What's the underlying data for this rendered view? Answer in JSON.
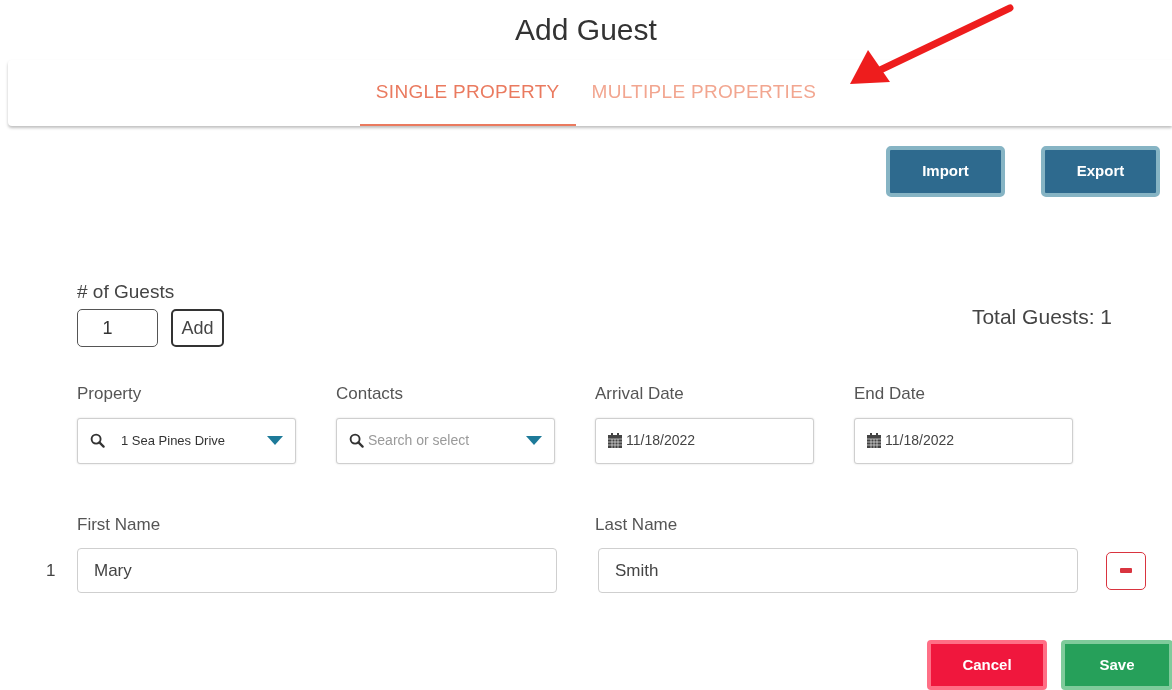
{
  "title": "Add Guest",
  "tabs": [
    {
      "label": "SINGLE PROPERTY",
      "selected": true
    },
    {
      "label": "MULTIPLE PROPERTIES",
      "selected": false
    }
  ],
  "toolbar": [
    "Import",
    "Export"
  ],
  "guest_count": {
    "label": "# of Guests",
    "value": "1",
    "button": "Add"
  },
  "total_guests": "Total Guests: 1",
  "fields": [
    {
      "kind": "select",
      "label": "Property",
      "value": "1 Sea Pines Drive"
    },
    {
      "kind": "search",
      "label": "Contacts",
      "placeholder": "Search or select"
    },
    {
      "kind": "date",
      "label": "Arrival Date",
      "value": "11/18/2022"
    },
    {
      "kind": "date",
      "label": "End Date",
      "value": "11/18/2022"
    }
  ],
  "name_labels": [
    "First Name",
    "Last Name"
  ],
  "guests": [
    {
      "index": "1",
      "first_name": "Mary",
      "last_name": "Smith"
    }
  ],
  "actions": [
    {
      "kind": "cancel",
      "label": "Cancel"
    },
    {
      "kind": "save",
      "label": "Save"
    }
  ]
}
